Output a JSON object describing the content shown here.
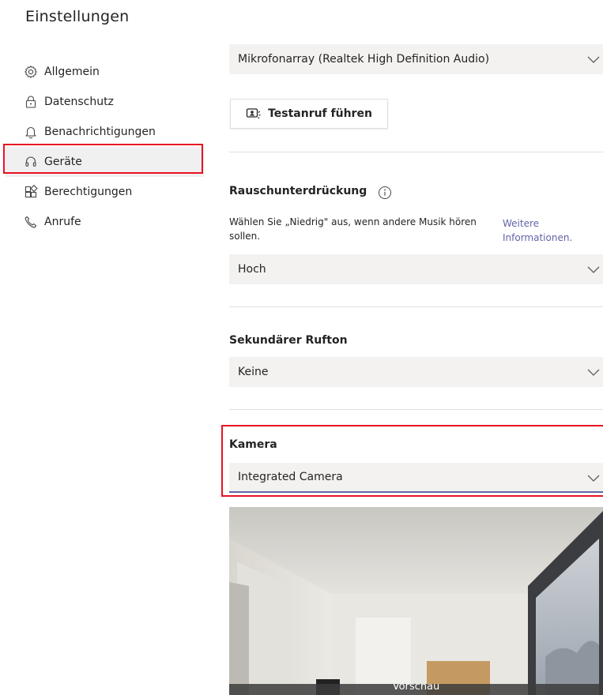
{
  "page_title": "Einstellungen",
  "sidebar": {
    "items": [
      {
        "label": "Allgemein",
        "icon": "gear-icon"
      },
      {
        "label": "Datenschutz",
        "icon": "lock-icon"
      },
      {
        "label": "Benachrichtigungen",
        "icon": "bell-icon"
      },
      {
        "label": "Geräte",
        "icon": "headset-icon",
        "selected": true
      },
      {
        "label": "Berechtigungen",
        "icon": "apps-icon"
      },
      {
        "label": "Anrufe",
        "icon": "phone-icon"
      }
    ]
  },
  "microphone": {
    "value": "Mikrofonarray (Realtek High Definition Audio)"
  },
  "test_call": {
    "label": "Testanruf führen",
    "icon": "test-call-icon"
  },
  "noise": {
    "heading": "Rauschunterdrückung",
    "description": "Wählen Sie „Niedrig\" aus, wenn andere Musik hören sollen.",
    "link": "Weitere Informationen.",
    "value": "Hoch"
  },
  "secondary_ringer": {
    "heading": "Sekundärer Rufton",
    "value": "Keine"
  },
  "camera": {
    "heading": "Kamera",
    "value": "Integrated Camera"
  },
  "preview": {
    "label": "Vorschau"
  },
  "colors": {
    "accent": "#6264a7",
    "highlight": "#e81123",
    "select_bg": "#f3f2f1"
  }
}
